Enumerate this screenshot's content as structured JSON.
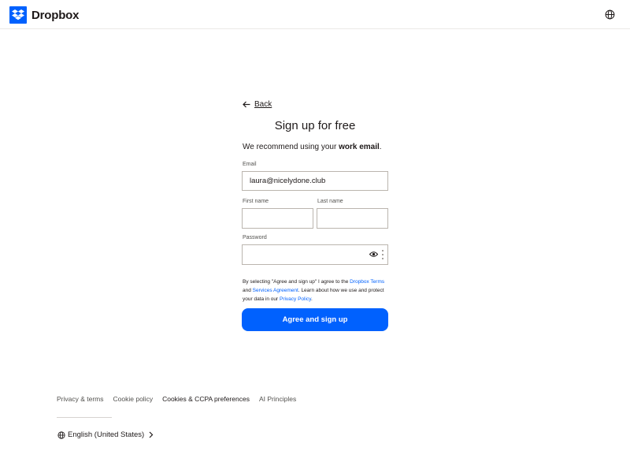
{
  "header": {
    "brand": "Dropbox",
    "brand_color": "#0061fe",
    "language_icon": "globe-icon"
  },
  "form": {
    "back_label": "Back",
    "title": "Sign up for free",
    "recommend_prefix": "We recommend using your ",
    "recommend_bold": "work email",
    "recommend_suffix": ".",
    "email_label": "Email",
    "email_value": "laura@nicelydone.club",
    "first_name_label": "First name",
    "first_name_value": "",
    "last_name_label": "Last name",
    "last_name_value": "",
    "password_label": "Password",
    "password_value": "",
    "legal": {
      "t1": "By selecting \"Agree and sign up\" I agree to the ",
      "link1": "Dropbox Terms",
      "t2": " and ",
      "link2": "Services Agreement",
      "t3": ". Learn about how we use and protect your data in our ",
      "link3": "Privacy Policy",
      "t4": "."
    },
    "submit_label": "Agree and sign up"
  },
  "footer": {
    "links": [
      "Privacy & terms",
      "Cookie policy",
      "Cookies & CCPA preferences",
      "AI Principles"
    ],
    "language": "English (United States)"
  }
}
